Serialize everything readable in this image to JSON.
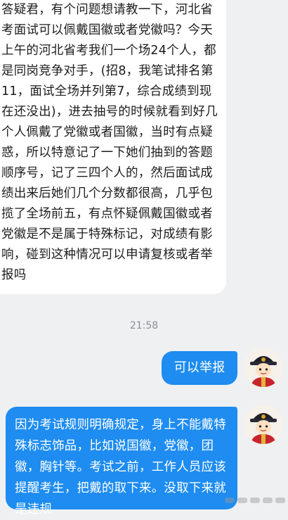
{
  "chat": {
    "incoming_message": "答疑君，有个问题想请教一下，河北省考面试可以佩戴国徽或者党徽吗？今天上午的河北省考我们一个场24个人，都是同岗竞争对手，(招8，我笔试排名第11，面试全场并列第7，综合成绩到现在还没出)，进去抽号的时候就看到好几个人佩戴了党徽或者国徽，当时有点疑惑，所以特意记了一下她们抽到的答题顺序号，记了三四个人的，然后面试成绩出来后她们几个分数都很高，几乎包揽了全场前五，有点怀疑佩戴国徽或者党徽是不是属于特殊标记，对成绩有影响，碰到这种情况可以申请复核或者举报吗",
    "timestamp": "21:58",
    "outgoing_short": "可以举报",
    "outgoing_long": "因为考试规则明确规定，身上不能戴特殊标志饰品，比如说国徽，党徽，团徽，胸针等。考试之前，工作人员应该提醒考生，把戴的取下来。没取下来就是违规"
  },
  "colors": {
    "background": "#eff0f2",
    "incoming_bubble": "#ffffff",
    "outgoing_bubble": "#1e8cf0"
  },
  "icons": {
    "avatar": "cartoon-official-avatar-icon",
    "watermark": "blurred-watermark"
  }
}
